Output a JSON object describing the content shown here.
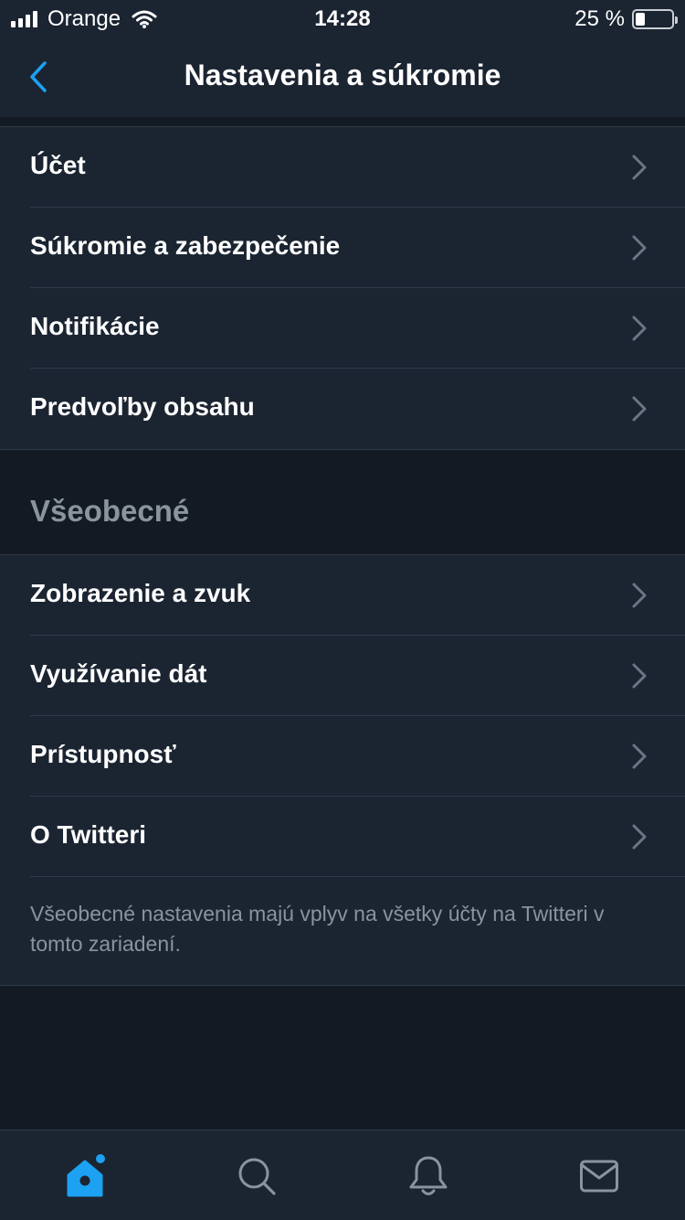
{
  "status_bar": {
    "carrier": "Orange",
    "time": "14:28",
    "battery_percent": "25 %",
    "battery_level": 0.25
  },
  "nav": {
    "title": "Nastavenia a súkromie",
    "back_icon": "chevron-left-icon"
  },
  "group_1": {
    "items": [
      {
        "label": "Účet"
      },
      {
        "label": "Súkromie a zabezpečenie"
      },
      {
        "label": "Notifikácie"
      },
      {
        "label": "Predvoľby obsahu"
      }
    ]
  },
  "general": {
    "header": "Všeobecné",
    "items": [
      {
        "label": "Zobrazenie a zvuk"
      },
      {
        "label": "Využívanie dát"
      },
      {
        "label": "Prístupnosť"
      },
      {
        "label": "O Twitteri"
      }
    ],
    "note": "Všeobecné nastavenia majú vplyv na všetky účty na Twitteri v tomto zariadení."
  },
  "tab_bar": {
    "tabs": [
      {
        "icon": "home-icon",
        "active": true
      },
      {
        "icon": "search-icon",
        "active": false
      },
      {
        "icon": "bell-icon",
        "active": false
      },
      {
        "icon": "mail-icon",
        "active": false
      }
    ]
  },
  "colors": {
    "background": "#141a23",
    "surface": "#1b2431",
    "divider": "#2f3a48",
    "accent": "#1da1f2",
    "muted_text": "#8a949f",
    "chevron": "#6b7684"
  }
}
